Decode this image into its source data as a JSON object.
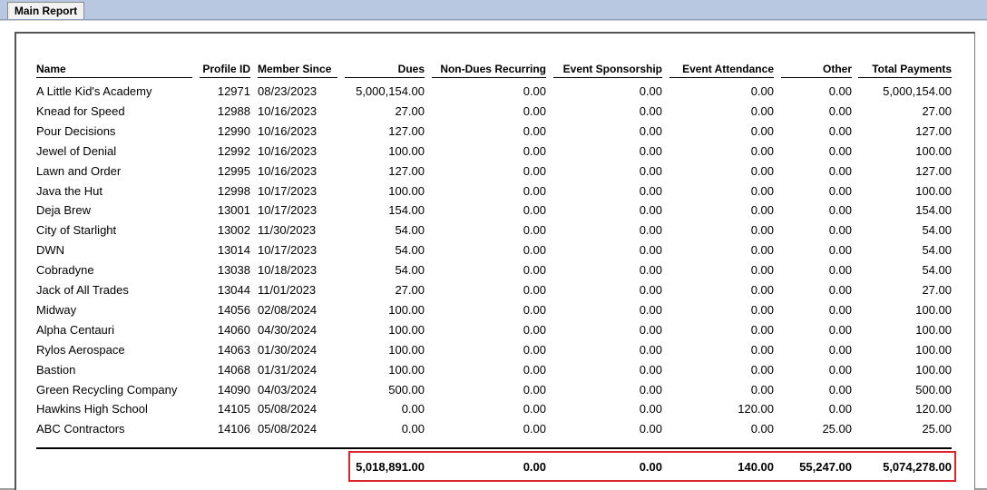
{
  "tab": {
    "label": "Main Report"
  },
  "headers": {
    "name": "Name",
    "profile_id": "Profile ID",
    "member_since": "Member Since",
    "dues": "Dues",
    "non_dues": "Non-Dues Recurring",
    "event_sponsorship": "Event Sponsorship",
    "event_attendance": "Event Attendance",
    "other": "Other",
    "total": "Total Payments"
  },
  "rows": [
    {
      "name": "A Little Kid's Academy",
      "profile_id": "12971",
      "member_since": "08/23/2023",
      "dues": "5,000,154.00",
      "non_dues": "0.00",
      "event_sponsorship": "0.00",
      "event_attendance": "0.00",
      "other": "0.00",
      "total": "5,000,154.00"
    },
    {
      "name": "Knead for Speed",
      "profile_id": "12988",
      "member_since": "10/16/2023",
      "dues": "27.00",
      "non_dues": "0.00",
      "event_sponsorship": "0.00",
      "event_attendance": "0.00",
      "other": "0.00",
      "total": "27.00"
    },
    {
      "name": "Pour Decisions",
      "profile_id": "12990",
      "member_since": "10/16/2023",
      "dues": "127.00",
      "non_dues": "0.00",
      "event_sponsorship": "0.00",
      "event_attendance": "0.00",
      "other": "0.00",
      "total": "127.00"
    },
    {
      "name": "Jewel of Denial",
      "profile_id": "12992",
      "member_since": "10/16/2023",
      "dues": "100.00",
      "non_dues": "0.00",
      "event_sponsorship": "0.00",
      "event_attendance": "0.00",
      "other": "0.00",
      "total": "100.00"
    },
    {
      "name": "Lawn and Order",
      "profile_id": "12995",
      "member_since": "10/16/2023",
      "dues": "127.00",
      "non_dues": "0.00",
      "event_sponsorship": "0.00",
      "event_attendance": "0.00",
      "other": "0.00",
      "total": "127.00"
    },
    {
      "name": "Java the Hut",
      "profile_id": "12998",
      "member_since": "10/17/2023",
      "dues": "100.00",
      "non_dues": "0.00",
      "event_sponsorship": "0.00",
      "event_attendance": "0.00",
      "other": "0.00",
      "total": "100.00"
    },
    {
      "name": "Deja Brew",
      "profile_id": "13001",
      "member_since": "10/17/2023",
      "dues": "154.00",
      "non_dues": "0.00",
      "event_sponsorship": "0.00",
      "event_attendance": "0.00",
      "other": "0.00",
      "total": "154.00"
    },
    {
      "name": "City of Starlight",
      "profile_id": "13002",
      "member_since": "11/30/2023",
      "dues": "54.00",
      "non_dues": "0.00",
      "event_sponsorship": "0.00",
      "event_attendance": "0.00",
      "other": "0.00",
      "total": "54.00"
    },
    {
      "name": "DWN",
      "profile_id": "13014",
      "member_since": "10/17/2023",
      "dues": "54.00",
      "non_dues": "0.00",
      "event_sponsorship": "0.00",
      "event_attendance": "0.00",
      "other": "0.00",
      "total": "54.00"
    },
    {
      "name": "Cobradyne",
      "profile_id": "13038",
      "member_since": "10/18/2023",
      "dues": "54.00",
      "non_dues": "0.00",
      "event_sponsorship": "0.00",
      "event_attendance": "0.00",
      "other": "0.00",
      "total": "54.00"
    },
    {
      "name": "Jack of All Trades",
      "profile_id": "13044",
      "member_since": "11/01/2023",
      "dues": "27.00",
      "non_dues": "0.00",
      "event_sponsorship": "0.00",
      "event_attendance": "0.00",
      "other": "0.00",
      "total": "27.00"
    },
    {
      "name": "Midway",
      "profile_id": "14056",
      "member_since": "02/08/2024",
      "dues": "100.00",
      "non_dues": "0.00",
      "event_sponsorship": "0.00",
      "event_attendance": "0.00",
      "other": "0.00",
      "total": "100.00"
    },
    {
      "name": "Alpha Centauri",
      "profile_id": "14060",
      "member_since": "04/30/2024",
      "dues": "100.00",
      "non_dues": "0.00",
      "event_sponsorship": "0.00",
      "event_attendance": "0.00",
      "other": "0.00",
      "total": "100.00"
    },
    {
      "name": "Rylos Aerospace",
      "profile_id": "14063",
      "member_since": "01/30/2024",
      "dues": "100.00",
      "non_dues": "0.00",
      "event_sponsorship": "0.00",
      "event_attendance": "0.00",
      "other": "0.00",
      "total": "100.00"
    },
    {
      "name": "Bastion",
      "profile_id": "14068",
      "member_since": "01/31/2024",
      "dues": "100.00",
      "non_dues": "0.00",
      "event_sponsorship": "0.00",
      "event_attendance": "0.00",
      "other": "0.00",
      "total": "100.00"
    },
    {
      "name": "Green Recycling Company",
      "profile_id": "14090",
      "member_since": "04/03/2024",
      "dues": "500.00",
      "non_dues": "0.00",
      "event_sponsorship": "0.00",
      "event_attendance": "0.00",
      "other": "0.00",
      "total": "500.00"
    },
    {
      "name": "Hawkins High School",
      "profile_id": "14105",
      "member_since": "05/08/2024",
      "dues": "0.00",
      "non_dues": "0.00",
      "event_sponsorship": "0.00",
      "event_attendance": "120.00",
      "other": "0.00",
      "total": "120.00"
    },
    {
      "name": "ABC Contractors",
      "profile_id": "14106",
      "member_since": "05/08/2024",
      "dues": "0.00",
      "non_dues": "0.00",
      "event_sponsorship": "0.00",
      "event_attendance": "0.00",
      "other": "25.00",
      "total": "25.00"
    }
  ],
  "totals": {
    "dues": "5,018,891.00",
    "non_dues": "0.00",
    "event_sponsorship": "0.00",
    "event_attendance": "140.00",
    "other": "55,247.00",
    "total": "5,074,278.00"
  },
  "colors": {
    "highlight_box": "#e0242e",
    "tab_bar": "#b8c8e0"
  }
}
